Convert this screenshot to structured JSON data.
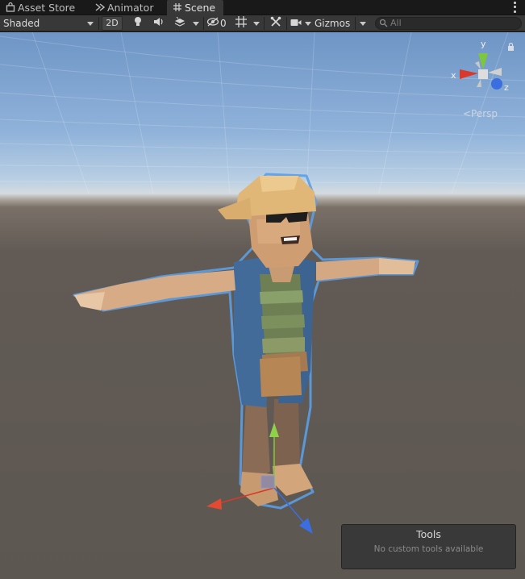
{
  "tabs": [
    {
      "label": "Asset Store",
      "icon": "shopping-bag-icon"
    },
    {
      "label": "Animator",
      "icon": "animator-icon"
    },
    {
      "label": "Scene",
      "icon": "grid-icon",
      "active": true
    }
  ],
  "toolbar": {
    "shading_mode": "Shaded",
    "mode_2d": "2D",
    "hidden_count": "0",
    "gizmos_label": "Gizmos",
    "search_placeholder": "All"
  },
  "gizmo": {
    "y_label": "y",
    "x_label": "x",
    "z_label": "z",
    "projection": "<Persp"
  },
  "tools_overlay": {
    "title": "Tools",
    "message": "No custom tools available"
  },
  "colors": {
    "tab_bar": "#191919",
    "toolbar": "#383838",
    "axis_x": "#d8392a",
    "axis_y": "#7ec63a",
    "axis_z": "#3b6ee0",
    "selection_outline": "#5b9ee6"
  }
}
